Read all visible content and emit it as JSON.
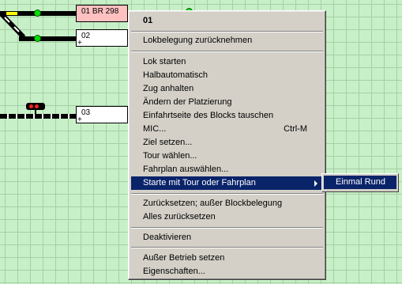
{
  "blocks": [
    {
      "label": "01 BR 298",
      "color": "#ffc0c0"
    },
    {
      "label": "02",
      "plus": "+"
    },
    {
      "label": "03",
      "plus": "+"
    }
  ],
  "menu": {
    "header": "01",
    "items": [
      "Lokbelegung zurücknehmen",
      "Lok starten",
      "Halbautomatisch",
      "Zug anhalten",
      "Ändern der Platzierung",
      "Einfahrtseite des Blocks tauschen",
      "MIC...",
      "Ziel setzen...",
      "Tour wählen...",
      "Fahrplan auswählen...",
      "Starte mit Tour oder Fahrplan",
      "Zurücksetzen; außer Blockbelegung",
      "Alles zurücksetzen",
      "Deaktivieren",
      "Außer Betrieb setzen",
      "Eigenschaften..."
    ],
    "mic_shortcut": "Ctrl-M",
    "highlighted": "Starte mit Tour oder Fahrplan"
  },
  "submenu": {
    "items": [
      "Einmal Rund"
    ]
  },
  "colors": {
    "background": "#c8f0c8",
    "menu": "#d4d0c8",
    "highlight": "#0a246a",
    "signal_green": "#00e000",
    "occupied_block": "#ffc0c0"
  }
}
